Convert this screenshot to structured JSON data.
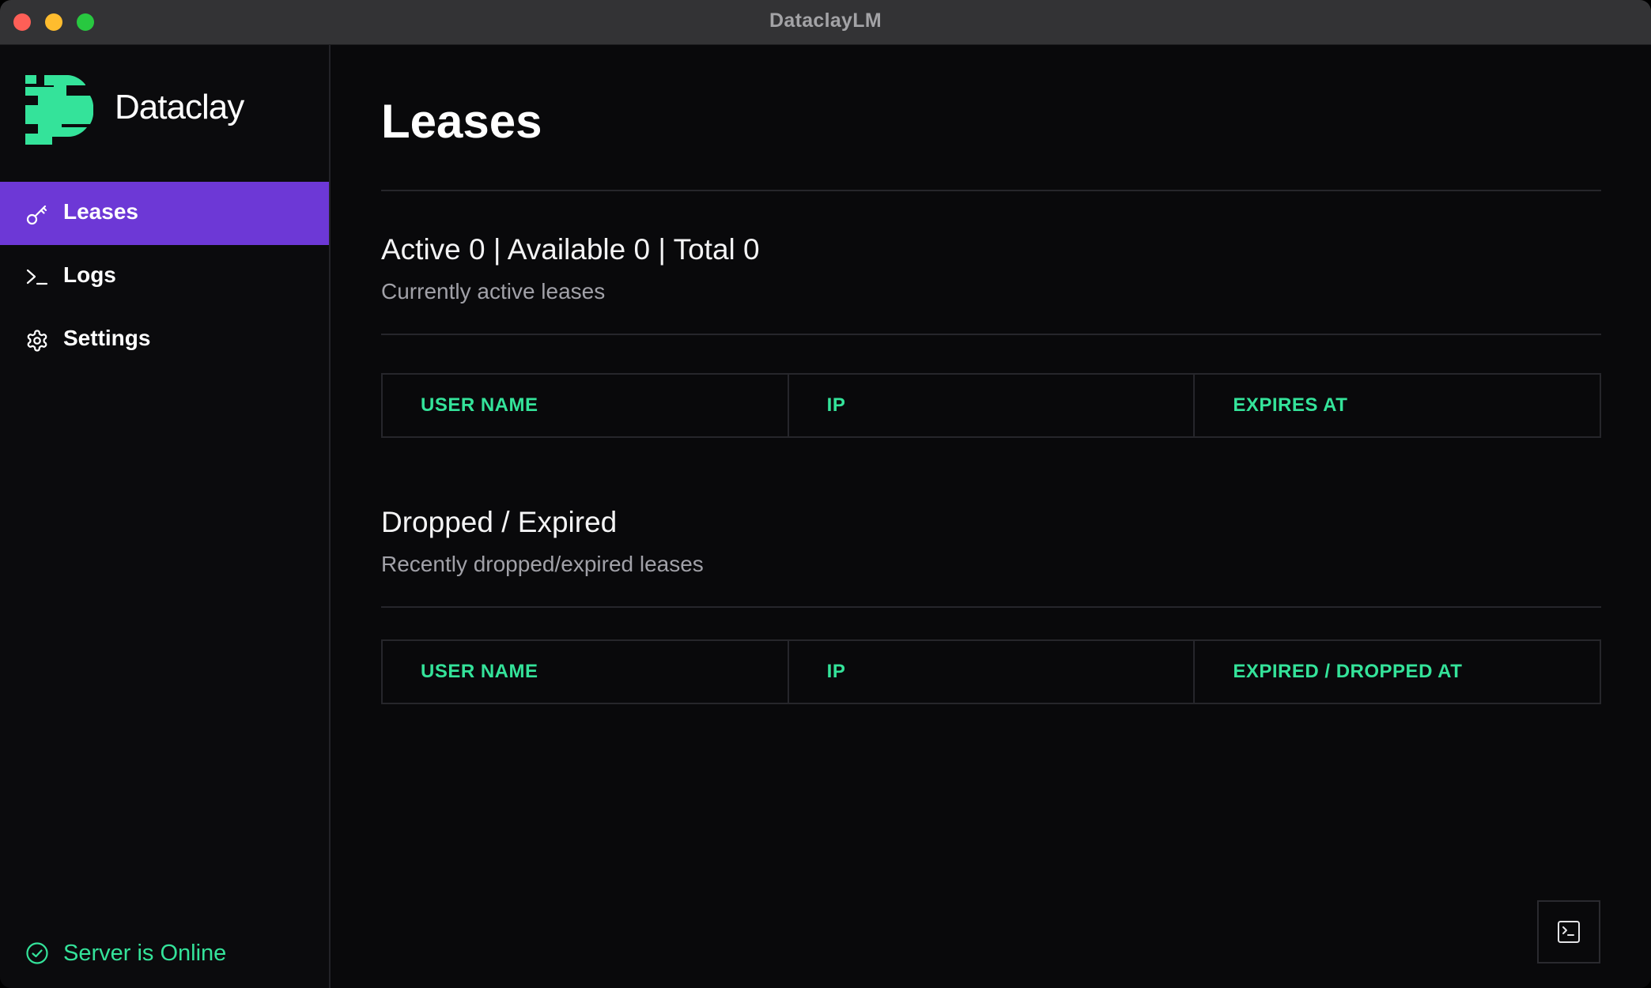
{
  "window": {
    "title": "DataclayLM"
  },
  "sidebar": {
    "brand": {
      "name": "Dataclay"
    },
    "items": [
      {
        "label": "Leases",
        "icon": "key-icon",
        "active": true
      },
      {
        "label": "Logs",
        "icon": "terminal-prompt-icon",
        "active": false
      },
      {
        "label": "Settings",
        "icon": "gear-icon",
        "active": false
      }
    ],
    "status": {
      "text": "Server is Online",
      "icon": "check-circle-icon"
    }
  },
  "main": {
    "title": "Leases",
    "active_section": {
      "title": "Active 0 | Available 0 | Total 0",
      "subtitle": "Currently active leases",
      "columns": [
        "USER NAME",
        "IP",
        "EXPIRES AT"
      ],
      "rows": []
    },
    "dropped_section": {
      "title": "Dropped / Expired",
      "subtitle": "Recently dropped/expired leases",
      "columns": [
        "USER NAME",
        "IP",
        "EXPIRED / DROPPED AT"
      ],
      "rows": []
    },
    "terminal_button": {
      "icon": "terminal-icon"
    }
  },
  "colors": {
    "accent_purple": "#6d38d6",
    "accent_green": "#34e39a",
    "background": "#09090b",
    "titlebar": "#333335"
  }
}
